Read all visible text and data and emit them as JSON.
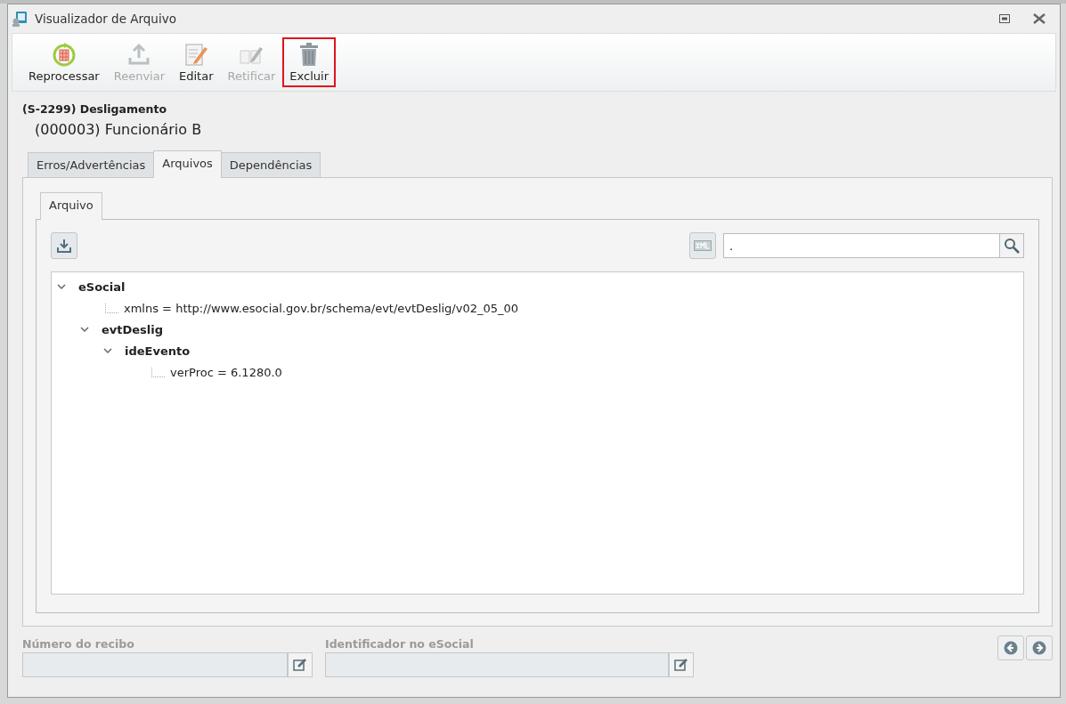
{
  "window": {
    "title": "Visualizador de Arquivo"
  },
  "toolbar": [
    {
      "label": "Reprocessar",
      "kind": "reprocess",
      "disabled": false,
      "highlighted": false
    },
    {
      "label": "Reenviar",
      "kind": "upload",
      "disabled": true,
      "highlighted": false
    },
    {
      "label": "Editar",
      "kind": "edit",
      "disabled": false,
      "highlighted": false
    },
    {
      "label": "Retificar",
      "kind": "rectify",
      "disabled": true,
      "highlighted": false
    },
    {
      "label": "Excluir",
      "kind": "delete",
      "disabled": false,
      "highlighted": true
    }
  ],
  "event": {
    "title": "(S-2299) Desligamento",
    "subtitle": "(000003) Funcionário B"
  },
  "tabs": [
    {
      "label": "Erros/Advertências",
      "selected": false
    },
    {
      "label": "Arquivos",
      "selected": true
    },
    {
      "label": "Dependências",
      "selected": false
    }
  ],
  "subtabs": [
    {
      "label": "Arquivo",
      "selected": true
    }
  ],
  "search": {
    "value": "."
  },
  "tree": [
    {
      "label": "eSocial",
      "kind": "element",
      "expanded": true,
      "children": [
        {
          "label": "xmlns = http://www.esocial.gov.br/schema/evt/evtDeslig/v02_05_00",
          "kind": "attribute"
        },
        {
          "label": "evtDeslig",
          "kind": "element",
          "expanded": true,
          "children": [
            {
              "label": "ideEvento",
              "kind": "element",
              "expanded": true,
              "children": [
                {
                  "label": "verProc = 6.1280.0",
                  "kind": "attribute"
                }
              ]
            }
          ]
        }
      ]
    }
  ],
  "footer": {
    "fields": [
      {
        "label": "Número do recibo",
        "disabled": true
      },
      {
        "label": "Identificador no eSocial",
        "disabled": true
      }
    ]
  }
}
